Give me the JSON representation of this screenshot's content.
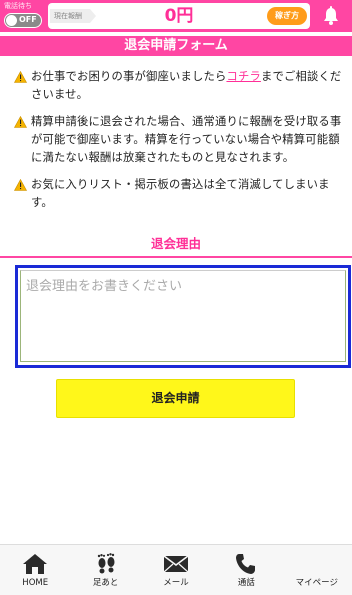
{
  "topbar": {
    "standby_label": "電話待ち",
    "toggle_state": "OFF",
    "reward_label": "現在報酬",
    "reward_amount": "0円",
    "earn_button": "稼ぎ方",
    "notification_icon": "bell-icon"
  },
  "form": {
    "title": "退会申請フォーム",
    "notices": [
      {
        "before": "お仕事でお困りの事が御座いましたら",
        "link": "コチラ",
        "after": "までご相談くださいませ。"
      },
      {
        "text": "精算申請後に退会された場合、通常通りに報酬を受け取る事が可能で御座います。精算を行っていない場合や精算可能額に満たない報酬は放棄されたものと見なされます。"
      },
      {
        "text": "お気に入りリスト・掲示板の書込は全て消滅してしまいます。"
      }
    ],
    "warning_icon": "warning-icon",
    "reason_title": "退会理由",
    "reason_placeholder": "退会理由をお書きください",
    "reason_value": "",
    "submit_label": "退会申請"
  },
  "bottom_nav": [
    {
      "label": "HOME",
      "icon": "home-icon"
    },
    {
      "label": "足あと",
      "icon": "footprints-icon"
    },
    {
      "label": "メール",
      "icon": "mail-icon"
    },
    {
      "label": "通話",
      "icon": "phone-icon"
    },
    {
      "label": "マイページ",
      "icon": "mypage-icon"
    }
  ],
  "colors": {
    "brand_pink": "#ff46a3",
    "accent_pink_text": "#ff2f97",
    "earn_button_orange": "#ff9c1a",
    "submit_yellow": "#fff71a",
    "focus_blue": "#1a2ad6"
  }
}
